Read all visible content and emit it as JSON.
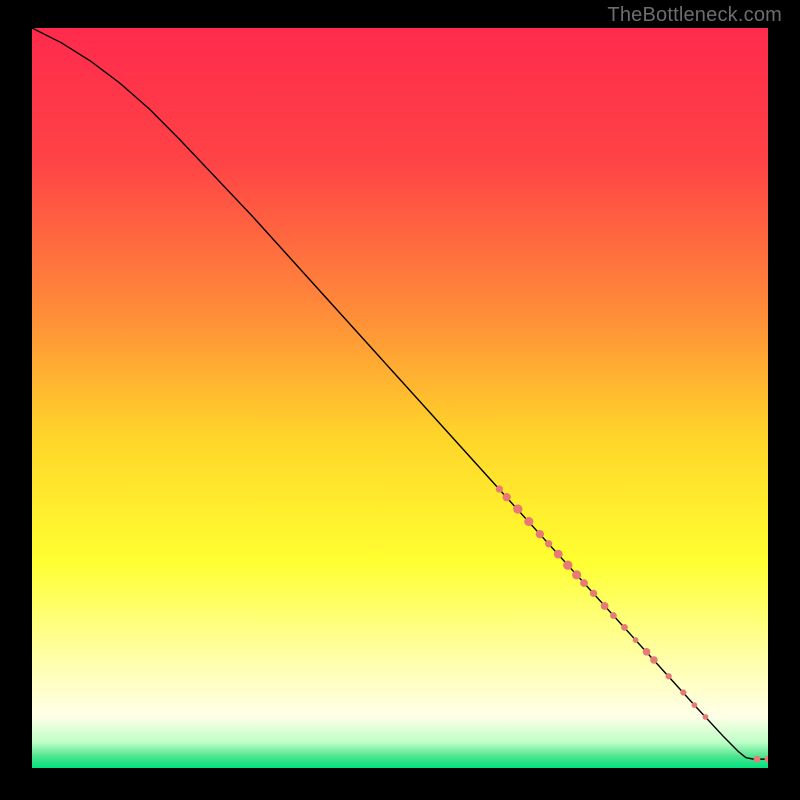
{
  "watermark": "TheBottleneck.com",
  "colors": {
    "letterbox": "#000000",
    "gradient_stops": [
      {
        "offset": 0.0,
        "color": "#ff2a4d"
      },
      {
        "offset": 0.18,
        "color": "#ff4346"
      },
      {
        "offset": 0.38,
        "color": "#ff8a39"
      },
      {
        "offset": 0.55,
        "color": "#ffd42a"
      },
      {
        "offset": 0.72,
        "color": "#ffff30"
      },
      {
        "offset": 0.86,
        "color": "#ffffb0"
      },
      {
        "offset": 0.93,
        "color": "#ffffe8"
      },
      {
        "offset": 0.965,
        "color": "#bfffc8"
      },
      {
        "offset": 0.985,
        "color": "#4be38e"
      },
      {
        "offset": 1.0,
        "color": "#00e37e"
      }
    ],
    "curve": "#000000",
    "dot_fill": "#e77a74",
    "dot_stroke": "#e77a74"
  },
  "chart_data": {
    "type": "line",
    "title": "",
    "xlabel": "",
    "ylabel": "",
    "xlim": [
      0,
      100
    ],
    "ylim": [
      0,
      100
    ],
    "curve": [
      {
        "x": 0,
        "y": 100
      },
      {
        "x": 4,
        "y": 98
      },
      {
        "x": 8,
        "y": 95.5
      },
      {
        "x": 12,
        "y": 92.5
      },
      {
        "x": 16,
        "y": 89
      },
      {
        "x": 20,
        "y": 85
      },
      {
        "x": 30,
        "y": 74.5
      },
      {
        "x": 40,
        "y": 63.5
      },
      {
        "x": 50,
        "y": 52.5
      },
      {
        "x": 60,
        "y": 41.5
      },
      {
        "x": 65,
        "y": 36
      },
      {
        "x": 70,
        "y": 30.5
      },
      {
        "x": 75,
        "y": 25
      },
      {
        "x": 80,
        "y": 19.5
      },
      {
        "x": 85,
        "y": 14
      },
      {
        "x": 90,
        "y": 8.5
      },
      {
        "x": 94,
        "y": 4.2
      },
      {
        "x": 96,
        "y": 2.2
      },
      {
        "x": 97,
        "y": 1.4
      },
      {
        "x": 98,
        "y": 1.2
      },
      {
        "x": 99,
        "y": 1.2
      },
      {
        "x": 100,
        "y": 1.2
      }
    ],
    "markers": [
      {
        "x": 63.5,
        "y": 37.7,
        "r": 2.8
      },
      {
        "x": 64.5,
        "y": 36.6,
        "r": 3.2
      },
      {
        "x": 66.0,
        "y": 35.0,
        "r": 3.6
      },
      {
        "x": 67.5,
        "y": 33.3,
        "r": 3.5
      },
      {
        "x": 69.0,
        "y": 31.6,
        "r": 3.2
      },
      {
        "x": 70.2,
        "y": 30.3,
        "r": 2.8
      },
      {
        "x": 71.5,
        "y": 28.9,
        "r": 3.4
      },
      {
        "x": 72.8,
        "y": 27.4,
        "r": 3.6
      },
      {
        "x": 74.0,
        "y": 26.1,
        "r": 3.5
      },
      {
        "x": 75.0,
        "y": 25.0,
        "r": 3.0
      },
      {
        "x": 76.3,
        "y": 23.6,
        "r": 2.8
      },
      {
        "x": 77.8,
        "y": 21.9,
        "r": 3.0
      },
      {
        "x": 79.0,
        "y": 20.6,
        "r": 2.6
      },
      {
        "x": 80.5,
        "y": 19.0,
        "r": 2.6
      },
      {
        "x": 82.0,
        "y": 17.3,
        "r": 2.2
      },
      {
        "x": 83.5,
        "y": 15.7,
        "r": 2.9
      },
      {
        "x": 84.5,
        "y": 14.6,
        "r": 2.9
      },
      {
        "x": 86.5,
        "y": 12.4,
        "r": 2.4
      },
      {
        "x": 88.5,
        "y": 10.2,
        "r": 2.4
      },
      {
        "x": 90.0,
        "y": 8.5,
        "r": 2.2
      },
      {
        "x": 91.5,
        "y": 6.9,
        "r": 2.2
      },
      {
        "x": 98.5,
        "y": 1.2,
        "r": 2.6
      },
      {
        "x": 100.0,
        "y": 1.2,
        "r": 2.6
      }
    ]
  }
}
